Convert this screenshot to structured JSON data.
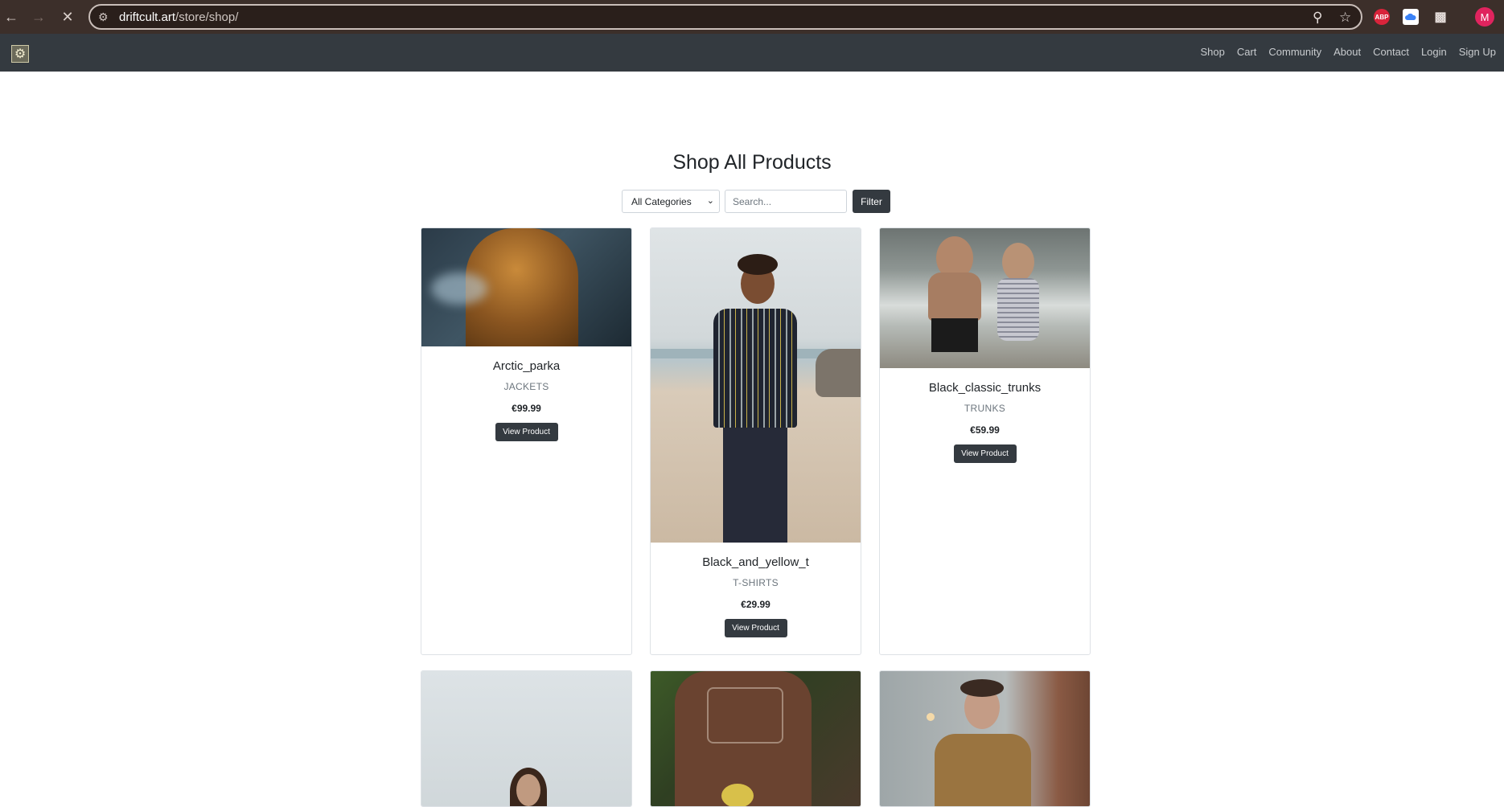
{
  "browser": {
    "url_host": "driftcult.art",
    "url_path": "/store/shop/",
    "avatar_letter": "M",
    "ext_abp": "ABP"
  },
  "navbar": {
    "links": [
      "Shop",
      "Cart",
      "Community",
      "About",
      "Contact",
      "Login",
      "Sign Up"
    ]
  },
  "main": {
    "title": "Shop All Products",
    "category_select": "All Categories",
    "search_placeholder": "Search...",
    "filter_label": "Filter"
  },
  "products": [
    {
      "name": "Arctic_parka",
      "category": "JACKETS",
      "price": "€99.99",
      "button": "View Product"
    },
    {
      "name": "Black_and_yellow_t",
      "category": "T-SHIRTS",
      "price": "€29.99",
      "button": "View Product"
    },
    {
      "name": "Black_classic_trunks",
      "category": "TRUNKS",
      "price": "€59.99",
      "button": "View Product"
    }
  ]
}
